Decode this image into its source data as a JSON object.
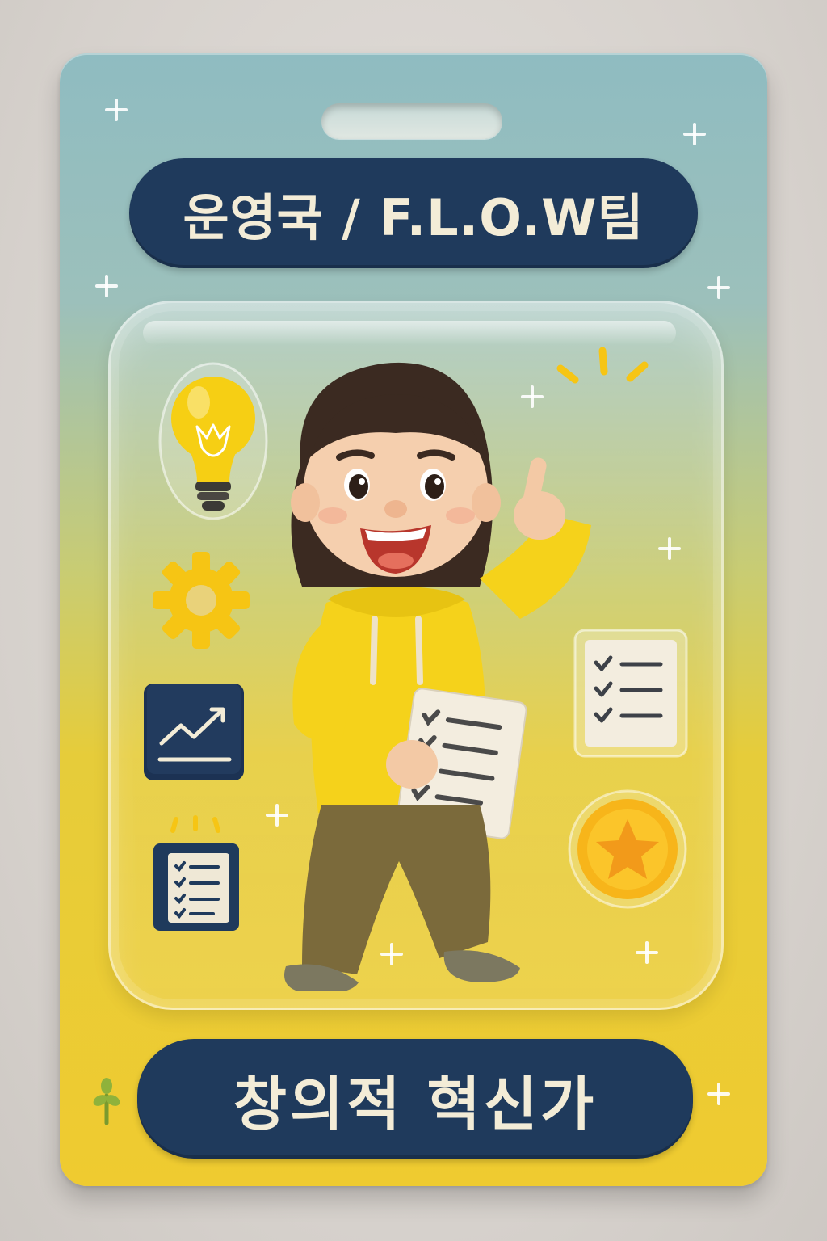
{
  "card": {
    "team_title": "운영국 / F.L.O.W팀",
    "role_title": "창의적 혁신가"
  },
  "icons": {
    "bulb": "light-bulb-icon",
    "gear": "gear-icon",
    "chart": "trend-chart-icon",
    "notebook": "checklist-notebook-icon",
    "checklist_card": "checklist-card-icon",
    "coin": "star-coin-icon",
    "sprout": "sprout-icon",
    "sparkle": "sparkle-plus-icon"
  },
  "colors": {
    "navy": "#1f3a5c",
    "cream": "#f3ecd7",
    "yellow": "#f5d01c",
    "teal": "#8fbcc1",
    "olive": "#7b6a3b"
  }
}
